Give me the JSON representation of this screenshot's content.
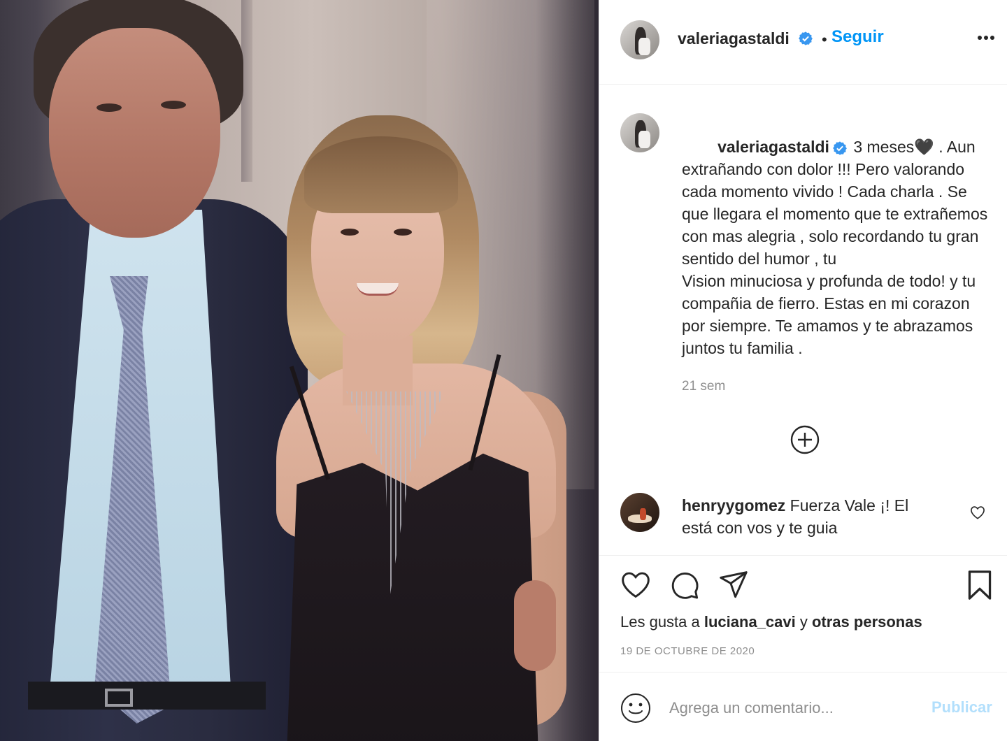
{
  "post": {
    "author": "valeriagastaldi",
    "follow_separator": "•",
    "follow_label": "Seguir",
    "caption_text": " 3 meses🖤 . Aun extrañando con dolor !!! Pero valorando cada momento vivido ! Cada charla . Se que llegara el momento que te extrañemos con mas alegria , solo recordando tu gran sentido del humor , tu\nVision minuciosa y profunda de todo! y tu compañia de fierro. Estas en mi corazon por siempre. Te amamos y te abrazamos juntos tu familia .",
    "time_ago": "21 sem",
    "likes_prefix": "Les gusta a ",
    "likes_user": "luciana_cavi",
    "likes_connector": " y ",
    "likes_others": "otras personas",
    "date": "19 DE OCTUBRE DE 2020"
  },
  "comments": [
    {
      "user": "henryygomez",
      "text": " Fuerza Vale ¡! El está con vos y te guia"
    }
  ],
  "add_comment": {
    "placeholder": "Agrega un comentario...",
    "publish_label": "Publicar"
  },
  "icons": {
    "verified": "verified-badge-icon",
    "more": "more-options-icon",
    "load_more": "plus-circle-icon",
    "comment_like": "heart-icon",
    "like": "heart-icon",
    "comment": "comment-bubble-icon",
    "share": "paper-plane-icon",
    "save": "bookmark-icon",
    "emoji": "emoji-icon"
  },
  "colors": {
    "accent": "#0095f6",
    "verified": "#3897f0",
    "muted": "#8e8e8e",
    "publish_disabled": "#b2dffc"
  }
}
